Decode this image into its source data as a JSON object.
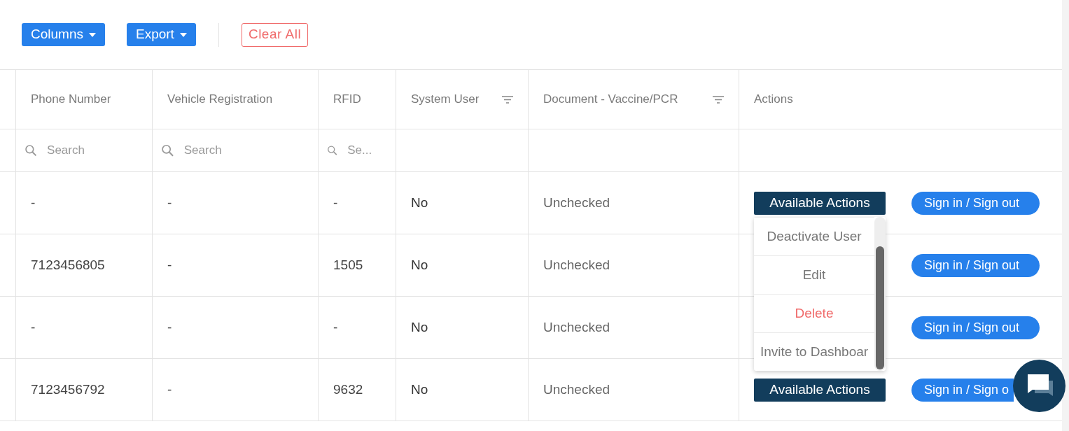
{
  "toolbar": {
    "buttons": [
      {
        "label": "Columns",
        "kind": "dropdown"
      },
      {
        "label": "Export",
        "kind": "dropdown"
      },
      {
        "label": "Clear All",
        "kind": "outline"
      }
    ]
  },
  "table": {
    "columns": [
      {
        "label": "Phone Number",
        "filter": false
      },
      {
        "label": "Vehicle Registration",
        "filter": false
      },
      {
        "label": "RFID",
        "filter": false
      },
      {
        "label": "System User",
        "filter": true
      },
      {
        "label": "Document - Vaccine/PCR",
        "filter": true
      },
      {
        "label": "Actions",
        "filter": false
      }
    ],
    "search_placeholders": [
      "Search",
      "Search",
      "Se..."
    ],
    "rows": [
      {
        "phone": "-",
        "vehicle": "-",
        "rfid": "-",
        "system_user": "No",
        "document": "Unchecked",
        "actions_button": "Available Actions",
        "sign_button": "Sign in / Sign out"
      },
      {
        "phone": "7123456805",
        "vehicle": "-",
        "rfid": "1505",
        "system_user": "No",
        "document": "Unchecked",
        "sign_button": "Sign in / Sign out"
      },
      {
        "phone": "-",
        "vehicle": "-",
        "rfid": "-",
        "system_user": "No",
        "document": "Unchecked",
        "sign_button": "Sign in / Sign out"
      },
      {
        "phone": "7123456792",
        "vehicle": "-",
        "rfid": "9632",
        "system_user": "No",
        "document": "Unchecked",
        "actions_button": "Available Actions",
        "sign_button": "Sign in / Sign o",
        "clipped": true
      }
    ]
  },
  "actions_menu": {
    "items": [
      {
        "label": "Deactivate User",
        "kind": "normal"
      },
      {
        "label": "Edit",
        "kind": "normal"
      },
      {
        "label": "Delete",
        "kind": "danger"
      },
      {
        "label": "Invite to Dashboar",
        "kind": "normal"
      }
    ]
  }
}
